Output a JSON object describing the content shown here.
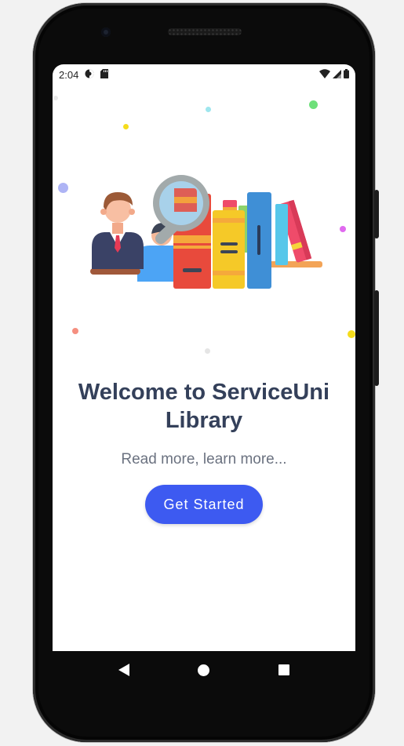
{
  "status_bar": {
    "time": "2:04",
    "icons": [
      "data-saver-icon",
      "sd-card-icon",
      "wifi-icon",
      "cell-signal-icon",
      "battery-icon"
    ]
  },
  "welcome": {
    "title": "Welcome to ServiceUni Library",
    "subtitle": "Read more, learn more...",
    "cta_label": "Get Started"
  },
  "nav_bar": {
    "icons": [
      "back-icon",
      "home-icon",
      "recents-icon"
    ]
  },
  "colors": {
    "accent": "#3d5af1",
    "title": "#34405a",
    "subtitle": "#6b7280"
  }
}
